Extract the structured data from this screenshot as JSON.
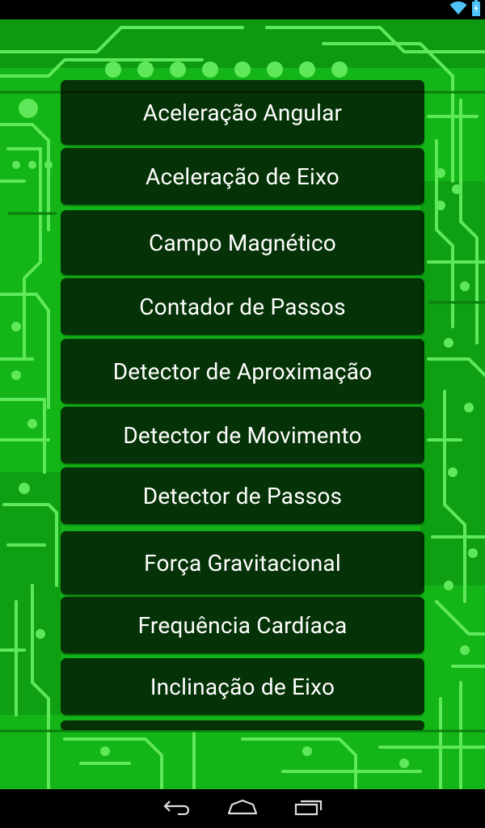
{
  "status_bar": {
    "icons": [
      "wifi-icon",
      "battery-charging-icon"
    ]
  },
  "background": {
    "theme": "green-circuit-board",
    "base_color": "#13b517",
    "trace_color": "#5fe95a",
    "dark_color": "#0a7e0d"
  },
  "menu": {
    "items": [
      {
        "label": "Aceleração Angular"
      },
      {
        "label": "Aceleração de Eixo"
      },
      {
        "label": "Campo Magnético"
      },
      {
        "label": "Contador de Passos"
      },
      {
        "label": "Detector de Aproximação"
      },
      {
        "label": "Detector de Movimento"
      },
      {
        "label": "Detector de Passos"
      },
      {
        "label": "Força Gravitacional"
      },
      {
        "label": "Frequência Cardíaca"
      },
      {
        "label": "Inclinação de Eixo"
      }
    ]
  },
  "nav_bar": {
    "buttons": [
      "back-icon",
      "home-icon",
      "recent-apps-icon"
    ]
  }
}
